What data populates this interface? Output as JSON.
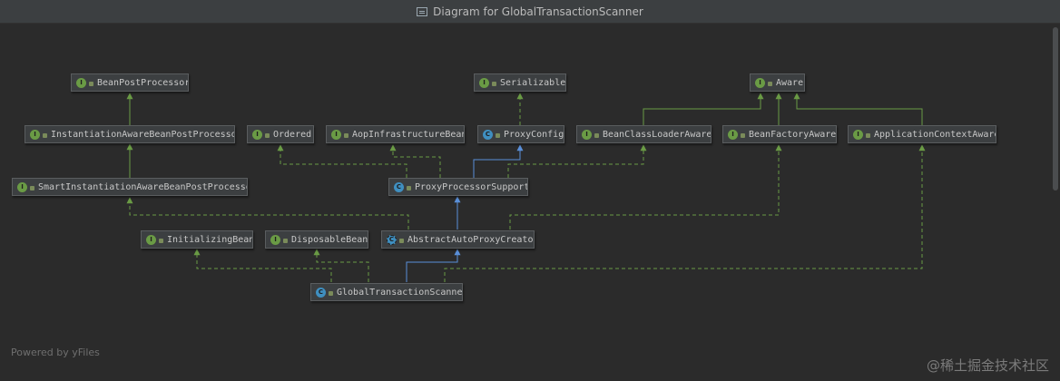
{
  "window": {
    "title": "Diagram for GlobalTransactionScanner"
  },
  "footer": {
    "powered_by": "Powered by yFiles"
  },
  "watermark": {
    "text": "@稀土掘金技术社区"
  },
  "colors": {
    "background": "#2b2b2b",
    "implements": "#6a9b45",
    "extends": "#5a8fd8",
    "node_bg": "#3c3f41"
  },
  "nodes": {
    "beanpostprocessor": {
      "label": "BeanPostProcessor",
      "kind": "interface"
    },
    "serializable": {
      "label": "Serializable",
      "kind": "interface"
    },
    "aware": {
      "label": "Aware",
      "kind": "interface"
    },
    "instantiationaware": {
      "label": "InstantiationAwareBeanPostProcessor",
      "kind": "interface"
    },
    "ordered": {
      "label": "Ordered",
      "kind": "interface"
    },
    "aopinfra": {
      "label": "AopInfrastructureBean",
      "kind": "interface"
    },
    "proxyconfig": {
      "label": "ProxyConfig",
      "kind": "class"
    },
    "beanclassloaderaware": {
      "label": "BeanClassLoaderAware",
      "kind": "interface"
    },
    "beanfactoryaware": {
      "label": "BeanFactoryAware",
      "kind": "interface"
    },
    "applicationcontextaware": {
      "label": "ApplicationContextAware",
      "kind": "interface"
    },
    "smartinstantiationaware": {
      "label": "SmartInstantiationAwareBeanPostProcessor",
      "kind": "interface"
    },
    "proxyprocessorsupport": {
      "label": "ProxyProcessorSupport",
      "kind": "class"
    },
    "initializingbean": {
      "label": "InitializingBean",
      "kind": "interface"
    },
    "disposablebean": {
      "label": "DisposableBean",
      "kind": "interface"
    },
    "abstractautoproxycreator": {
      "label": "AbstractAutoProxyCreator",
      "kind": "abstract"
    },
    "globaltransactionscanner": {
      "label": "GlobalTransactionScanner",
      "kind": "class"
    }
  }
}
